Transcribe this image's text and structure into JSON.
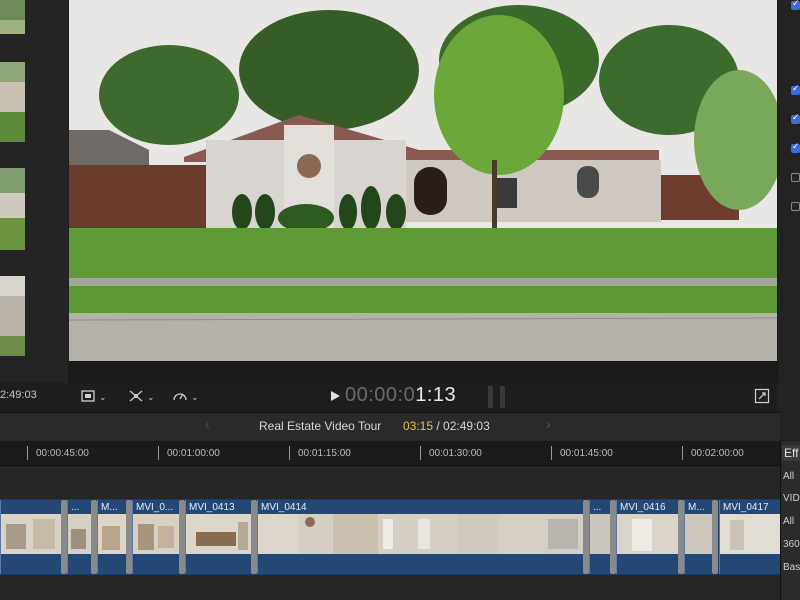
{
  "browser": {
    "timecode": "2:49:03"
  },
  "viewer": {
    "timecode_dim": "00:00:0",
    "timecode_lit": "1:13"
  },
  "controls": {
    "crop_icon": "crop-icon",
    "transform_icon": "transform-icon",
    "speed_icon": "speed-icon",
    "play_icon": "play-icon",
    "fullscreen_icon": "fullscreen-icon"
  },
  "project": {
    "name": "Real Estate Video Tour",
    "current": "03:15",
    "separator": " / ",
    "total": "02:49:03"
  },
  "ruler": {
    "labels": [
      "00:00:45:00",
      "00:01:00:00",
      "00:01:15:00",
      "00:01:30:00",
      "00:01:45:00",
      "00:02:00:00"
    ]
  },
  "clips": [
    {
      "label": ""
    },
    {
      "label": "..."
    },
    {
      "label": "M..."
    },
    {
      "label": "MVI_0..."
    },
    {
      "label": "MVI_0413"
    },
    {
      "label": "MVI_0414"
    },
    {
      "label": "..."
    },
    {
      "label": "MVI_0416"
    },
    {
      "label": "M..."
    },
    {
      "label": "MVI_0417"
    }
  ],
  "effects": {
    "title": "Eff",
    "items": [
      "All",
      "VID",
      "All",
      "360",
      "Bas"
    ]
  },
  "colors": {
    "accent_timecode": "#e6c04a",
    "clip_blue": "#234875",
    "checkbox_blue": "#3a6ed4"
  }
}
